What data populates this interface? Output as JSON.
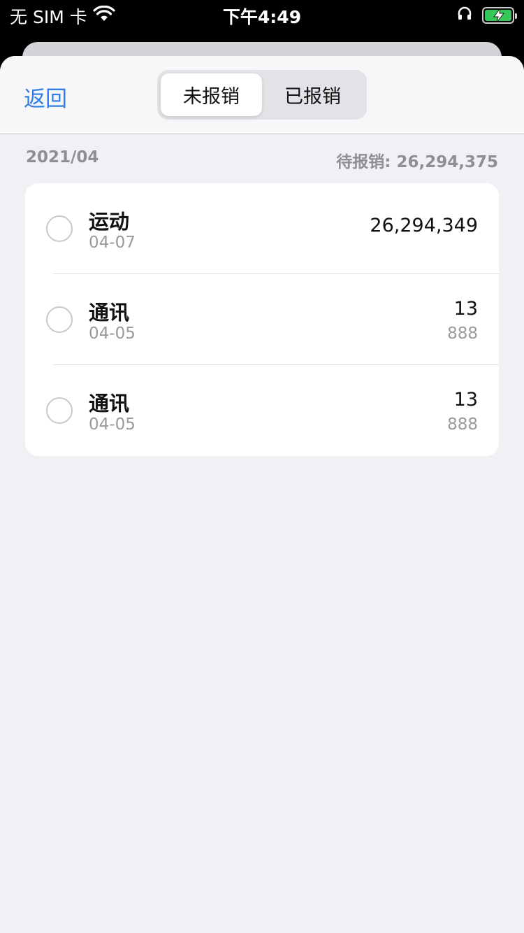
{
  "status_bar": {
    "carrier": "无 SIM 卡",
    "time": "下午4:49"
  },
  "nav": {
    "back_label": "返回",
    "segments": [
      {
        "label": "未报销",
        "selected": true
      },
      {
        "label": "已报销",
        "selected": false
      }
    ]
  },
  "summary": {
    "period": "2021/04",
    "pending": "待报销: 26,294,375"
  },
  "items": [
    {
      "title": "运动",
      "date": "04-07",
      "amount": "26,294,349",
      "sub": ""
    },
    {
      "title": "通讯",
      "date": "04-05",
      "amount": "13",
      "sub": "888"
    },
    {
      "title": "通讯",
      "date": "04-05",
      "amount": "13",
      "sub": "888"
    }
  ],
  "colors": {
    "accent": "#2f7ee6",
    "battery": "#34c759",
    "background": "#f0f0f5"
  }
}
